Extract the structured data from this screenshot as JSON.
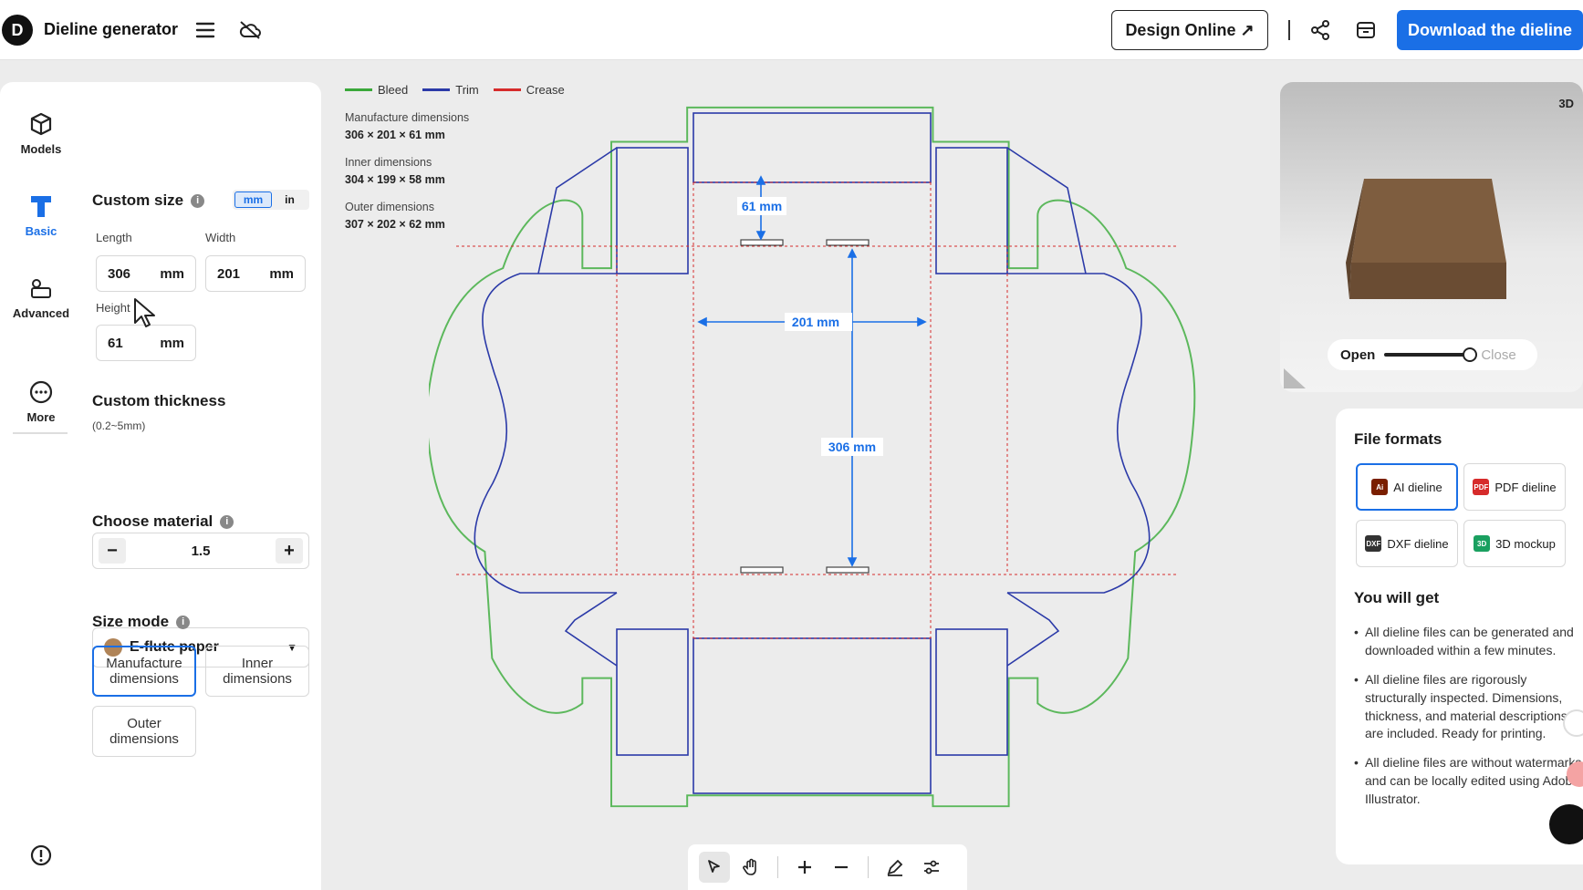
{
  "header": {
    "logo_letter": "D",
    "app_title": "Dieline generator",
    "design_online_label": "Design Online ↗",
    "download_label": "Download the dieline"
  },
  "rail": {
    "items": [
      {
        "label": "Models",
        "icon": "cube-icon"
      },
      {
        "label": "Basic",
        "icon": "shirt-icon"
      },
      {
        "label": "Advanced",
        "icon": "shapes-icon"
      },
      {
        "label": "More",
        "icon": "more-icon"
      }
    ],
    "bottom_icon": "alert-circle-icon"
  },
  "settings": {
    "custom_size_title": "Custom size",
    "unit_mm": "mm",
    "unit_in": "in",
    "length_label": "Length",
    "length_value": "306",
    "width_label": "Width",
    "width_value": "201",
    "height_label": "Height",
    "height_value": "61",
    "unit_suffix": "mm",
    "thickness_title": "Custom thickness",
    "thickness_range": "(0.2~5mm)",
    "thickness_value": "1.5",
    "minus": "−",
    "plus": "+",
    "material_title": "Choose material",
    "material_value": "E-flute paper",
    "size_mode_title": "Size mode",
    "mode_manufacture": "Manufacture dimensions",
    "mode_inner": "Inner dimensions",
    "mode_outer": "Outer dimensions"
  },
  "canvas": {
    "legend": [
      {
        "label": "Bleed",
        "color": "#3aa83a"
      },
      {
        "label": "Trim",
        "color": "#2b3aa8"
      },
      {
        "label": "Crease",
        "color": "#d62b2b"
      }
    ],
    "dims": [
      {
        "label": "Manufacture dimensions",
        "value": "306 × 201 × 61 mm"
      },
      {
        "label": "Inner dimensions",
        "value": "304 × 199 × 58 mm"
      },
      {
        "label": "Outer dimensions",
        "value": "307 × 202 × 62 mm"
      }
    ],
    "measure_height": "61 mm",
    "measure_width": "201 mm",
    "measure_length": "306 mm"
  },
  "toolbar": {
    "tools": [
      "pointer-icon",
      "hand-icon",
      "zoom-in-icon",
      "zoom-out-icon",
      "pen-icon",
      "sliders-icon"
    ]
  },
  "preview": {
    "badge": "3D",
    "open_label": "Open",
    "close_label": "Close",
    "open_state": 1.0
  },
  "formats": {
    "title": "File formats",
    "items": [
      {
        "label": "AI dieline",
        "icon_text": "Ai",
        "color": "#7a1f00"
      },
      {
        "label": "PDF dieline",
        "icon_text": "PDF",
        "color": "#d62b2b"
      },
      {
        "label": "DXF dieline",
        "icon_text": "DXF",
        "color": "#333333"
      },
      {
        "label": "3D mockup",
        "icon_text": "3D",
        "color": "#1aa060"
      }
    ],
    "get_title": "You will get",
    "bullets": [
      "All dieline files can be generated and downloaded within a few minutes.",
      "All dieline files are rigorously structurally inspected. Dimensions, thickness, and material descriptions are included. Ready for printing.",
      "All dieline files are without watermarks and can be locally edited using Adobe Illustrator."
    ]
  }
}
